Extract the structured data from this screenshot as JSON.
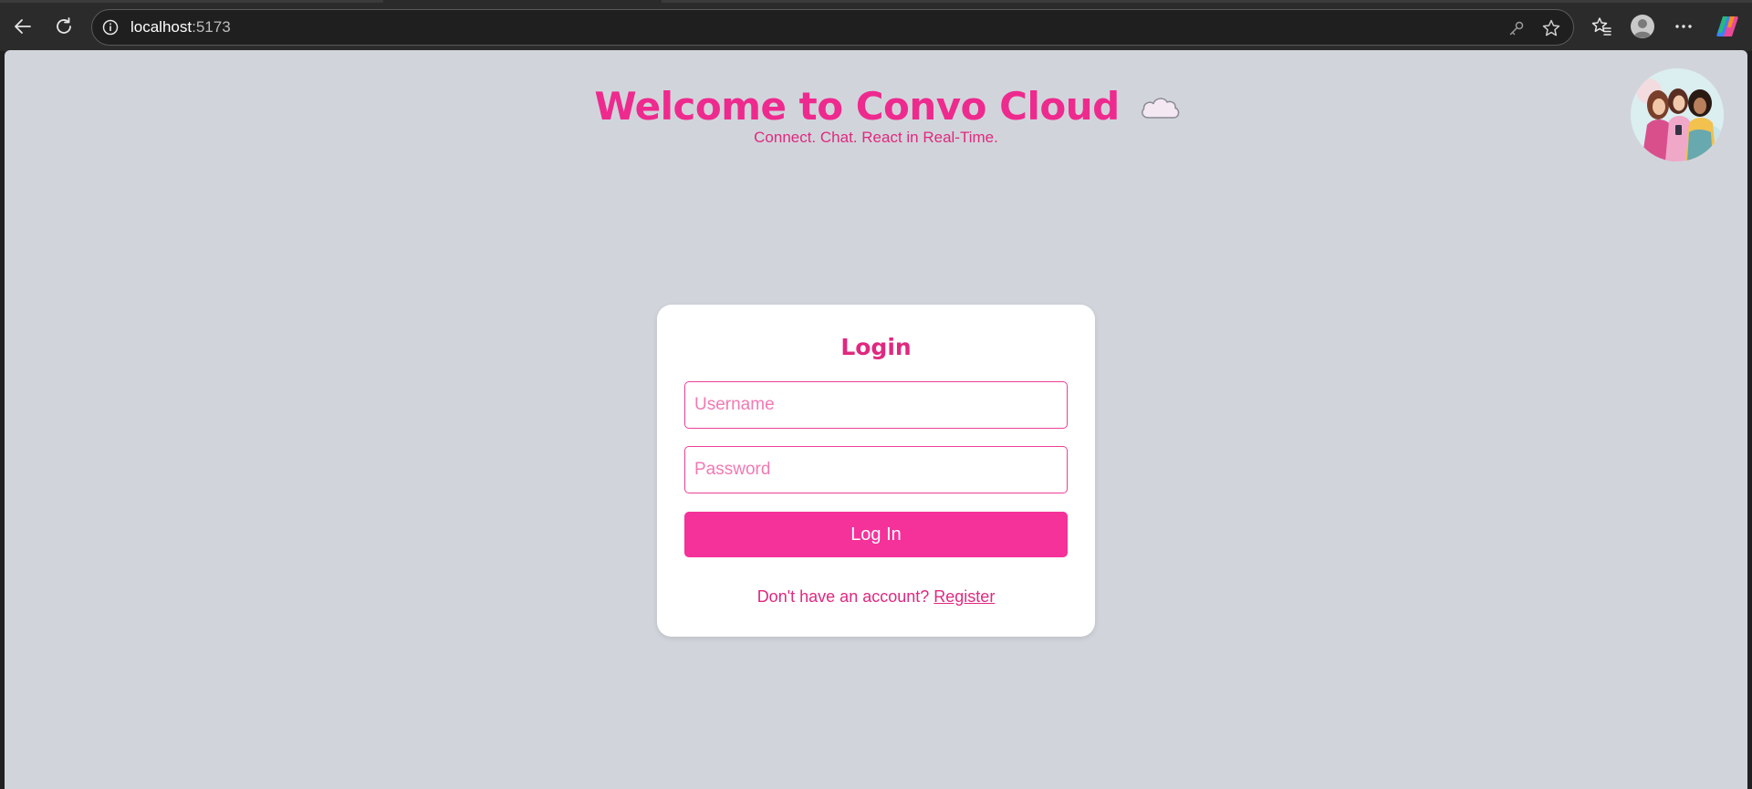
{
  "browser": {
    "address": {
      "host": "localhost",
      "port": ":5173"
    },
    "icons": {
      "back": "arrow-left-icon",
      "refresh": "refresh-icon",
      "site_info": "info-icon",
      "key": "key-icon",
      "favorite": "star-icon",
      "favorites": "favorites-icon",
      "profile": "profile-icon",
      "more": "more-icon",
      "copilot": "copilot-icon"
    }
  },
  "header": {
    "title": "Welcome to Convo Cloud",
    "subtitle": "Connect. Chat. React in Real-Time."
  },
  "login": {
    "title": "Login",
    "username_placeholder": "Username",
    "username_value": "",
    "password_placeholder": "Password",
    "password_value": "",
    "submit_label": "Log In",
    "register_prompt": "Don't have an account?",
    "register_link": "Register"
  },
  "colors": {
    "brand_pink": "#ee2a8e",
    "button_pink": "#f5319a",
    "page_background": "#d1d5db"
  }
}
